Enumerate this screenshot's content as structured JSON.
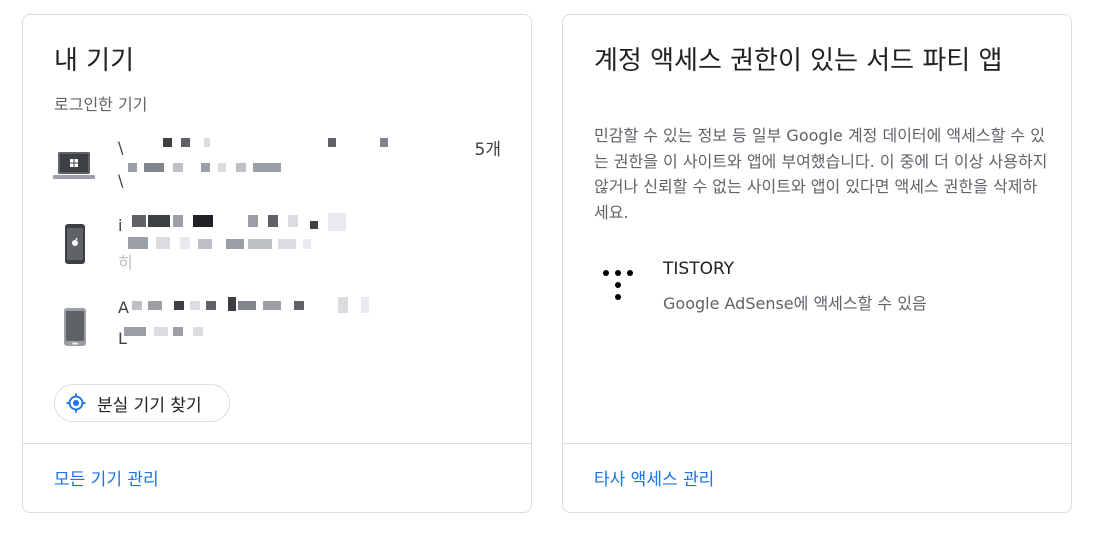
{
  "devices_card": {
    "title": "내 기기",
    "subtitle": "로그인한 기기",
    "count": "5개",
    "devices": [
      {
        "icon": "laptop-icon",
        "lead": [
          "\\",
          "\\"
        ]
      },
      {
        "icon": "iphone-icon",
        "lead": [
          "i",
          "히"
        ]
      },
      {
        "icon": "android-phone-icon",
        "lead": [
          "A",
          "L"
        ]
      }
    ],
    "find_device_label": "분실 기기 찾기",
    "manage_all_label": "모든 기기 관리"
  },
  "third_party_card": {
    "title": "계정 액세스 권한이 있는 서드 파티 앱",
    "description": "민감할 수 있는 정보 등 일부 Google 계정 데이터에 액세스할 수 있는 권한을 이 사이트와 앱에 부여했습니다. 이 중에 더 이상 사용하지 않거나 신뢰할 수 없는 사이트와 앱이 있다면 액세스 권한을 삭제하세요.",
    "apps": [
      {
        "name": "TISTORY",
        "access": "Google AdSense에 액세스할 수 있음"
      }
    ],
    "manage_label": "타사 액세스 관리"
  },
  "colors": {
    "link": "#1a73e8",
    "border": "#dadce0",
    "secondary_text": "#5f6368"
  }
}
